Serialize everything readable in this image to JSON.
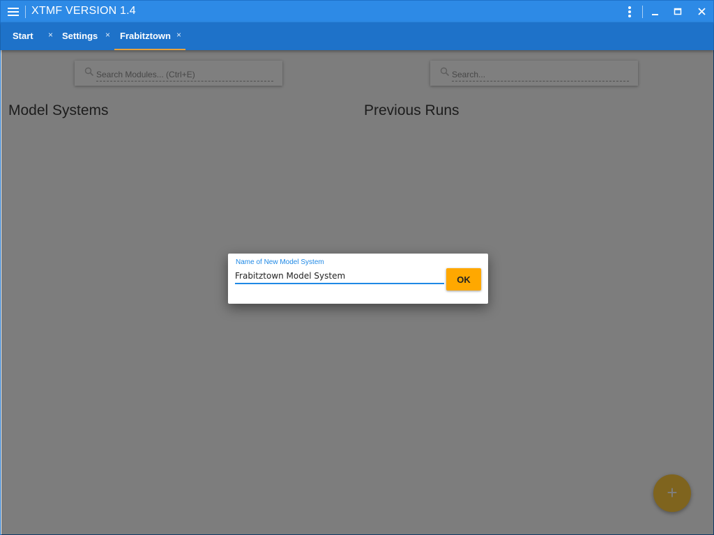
{
  "window": {
    "title": "XTMF VERSION 1.4"
  },
  "tabs": [
    {
      "label": "Start",
      "close": "×"
    },
    {
      "label": "Settings",
      "close": "×"
    },
    {
      "label": "Frabitztown",
      "close": "×",
      "active": true
    }
  ],
  "left_panel": {
    "search_placeholder": "Search Modules... (Ctrl+E)",
    "title": "Model Systems"
  },
  "right_panel": {
    "search_placeholder": "Search...",
    "title": "Previous Runs"
  },
  "fab": {
    "label": "+"
  },
  "dialog": {
    "field_label": "Name of New Model System",
    "field_value": "Frabitztown Model System",
    "ok_label": "OK"
  },
  "colors": {
    "titlebar": "#2d8ae6",
    "tabbar": "#1e72c9",
    "tab_underline": "#e8a33c",
    "input_accent": "#1e88e5",
    "ok_button": "#ffa800",
    "fab": "#ffc83d"
  },
  "icons": [
    "hamburger-menu-icon",
    "more-vert-icon",
    "minimize-icon",
    "maximize-icon",
    "close-icon",
    "search-icon",
    "plus-icon"
  ]
}
